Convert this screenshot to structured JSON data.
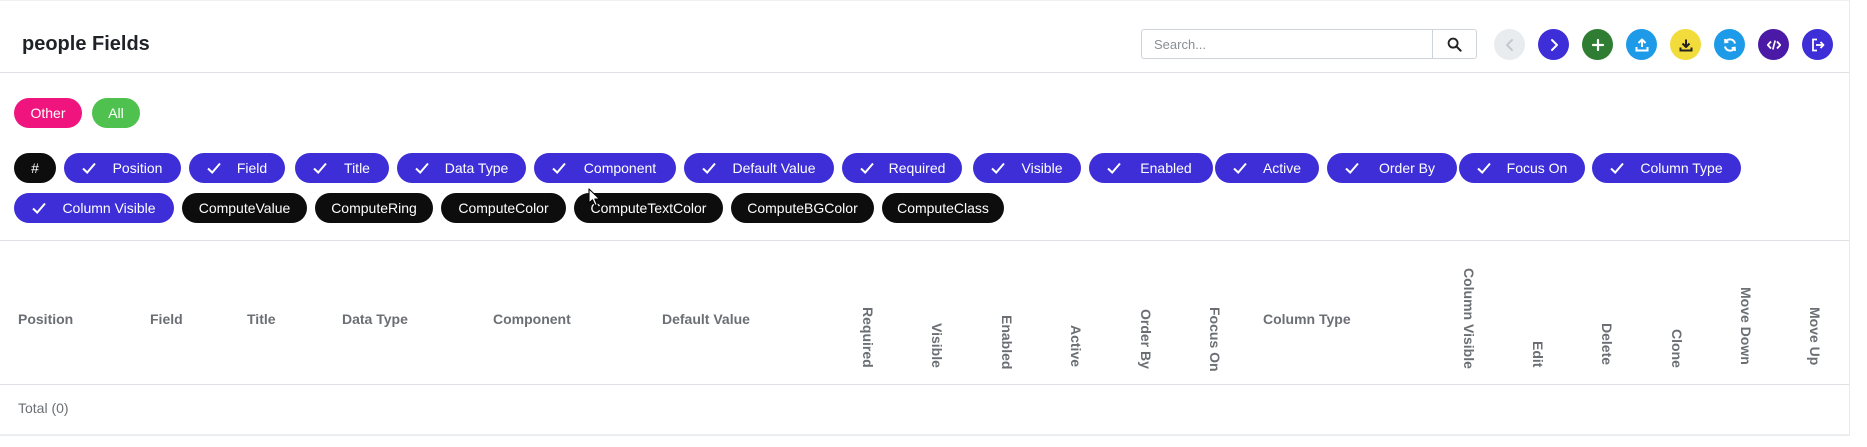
{
  "header": {
    "title": "people Fields",
    "search": {
      "placeholder": "Search...",
      "value": ""
    }
  },
  "toolbar": [
    {
      "name": "prev-button",
      "icon": "chevron-left-icon",
      "color": "#e9ecef",
      "disabled": true
    },
    {
      "name": "next-button",
      "icon": "chevron-right-icon",
      "color": "#3d2ed8"
    },
    {
      "name": "add-button",
      "icon": "plus-icon",
      "color": "#2e7d32"
    },
    {
      "name": "upload-button",
      "icon": "upload-icon",
      "color": "#1e9be8"
    },
    {
      "name": "download-button",
      "icon": "download-icon",
      "color": "#f2dc3c"
    },
    {
      "name": "refresh-button",
      "icon": "refresh-icon",
      "color": "#1e9be8"
    },
    {
      "name": "code-button",
      "icon": "code-icon",
      "color": "#4a1aa6"
    },
    {
      "name": "logout-button",
      "icon": "sign-out-icon",
      "color": "#3d2ed8"
    }
  ],
  "filters": {
    "other_label": "Other",
    "other_color": "#f0157e",
    "all_label": "All",
    "all_color": "#4fc14f"
  },
  "column_toggles": {
    "hash_label": "#",
    "checked": [
      "Position",
      "Field",
      "Title",
      "Data Type",
      "Component",
      "Default Value",
      "Required",
      "Visible",
      "Enabled",
      "Active",
      "Order By",
      "Focus On",
      "Column Type",
      "Column Visible"
    ],
    "unchecked": [
      "ComputeValue",
      "ComputeRing",
      "ComputeColor",
      "ComputeTextColor",
      "ComputeBGColor",
      "ComputeClass"
    ]
  },
  "table": {
    "headers": [
      "Position",
      "Field",
      "Title",
      "Data Type",
      "Component",
      "Default Value",
      "Required",
      "Visible",
      "Enabled",
      "Active",
      "Order By",
      "Focus On",
      "Column Type",
      "Column Visible",
      "Edit",
      "Delete",
      "Clone",
      "Move Down",
      "Move Up"
    ],
    "total_label": "Total (0)"
  },
  "colors": {
    "accent": "#3d2ed8",
    "dark_pill": "#0d0d0d"
  }
}
